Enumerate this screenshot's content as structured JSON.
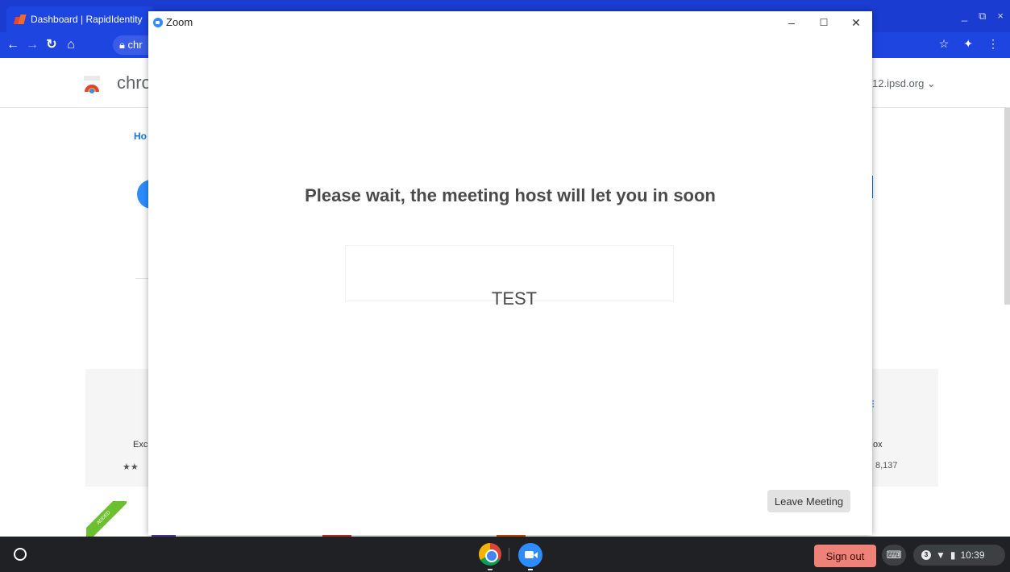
{
  "browser": {
    "tab": {
      "title": "Dashboard | RapidIdentity"
    },
    "url_visible": "chr",
    "window_controls": {
      "minimize": "_",
      "restore": "⧉",
      "close": "×"
    },
    "star": "☆",
    "extensions": "✦",
    "menu": "⋮"
  },
  "webstore": {
    "brand_partial": "chro",
    "account_partial": "12.ipsd.org ⌄",
    "breadcrumb_partial": "Ho",
    "left_ext": {
      "title_partial": "Exc",
      "stars": "★★"
    },
    "right_ext": {
      "title_partial": "ox",
      "count": "8,137"
    },
    "ribbon": "ADDED"
  },
  "zoom": {
    "window_title": "Zoom",
    "controls": {
      "minimize": "–",
      "maximize": "☐",
      "close": "✕"
    },
    "wait_message": "Please wait, the meeting host will let you in soon",
    "meeting_name": "TEST",
    "leave_button": "Leave Meeting"
  },
  "shelf": {
    "signout": "Sign out",
    "keyboard_icon": "⌨",
    "notification_count": "3",
    "time": "10:39"
  },
  "colors": {
    "chrome_frame": "#1a3cd1",
    "zoom_blue": "#2d8cff",
    "signout_bg": "#ee8178",
    "shelf_bg": "#202124"
  }
}
